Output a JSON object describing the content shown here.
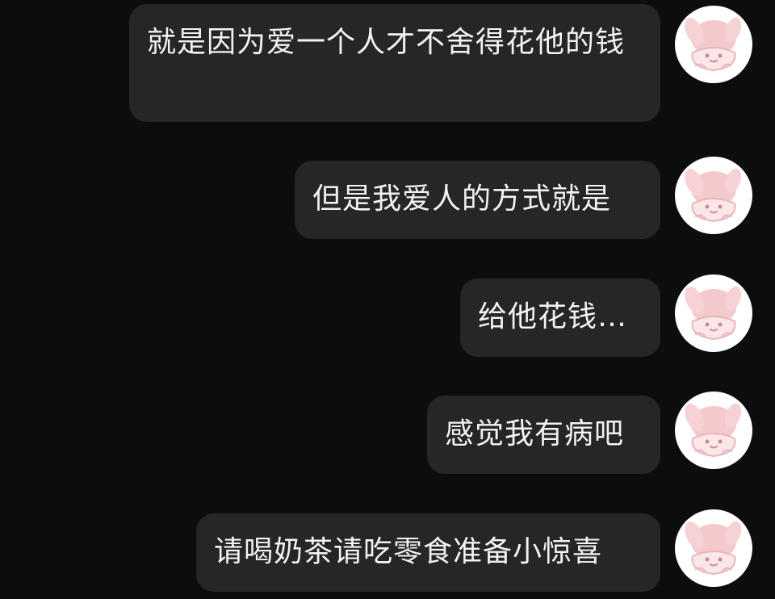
{
  "chat": {
    "messages": [
      {
        "text": "就是因为爱一个人才不舍得花他的钱",
        "side": "right"
      },
      {
        "text": "但是我爱人的方式就是",
        "side": "right"
      },
      {
        "text": "给他花钱…",
        "side": "right"
      },
      {
        "text": "感觉我有病吧",
        "side": "right"
      },
      {
        "text": "请喝奶茶请吃零食准备小惊喜",
        "side": "right"
      }
    ],
    "avatar_icon": "bunny-sticker-avatar-icon"
  },
  "colors": {
    "background": "#0d0d0d",
    "bubble": "#262626",
    "text": "#f2f2f2",
    "avatar_bg": "#ffffff",
    "avatar_accent": "#f4c9cc"
  }
}
